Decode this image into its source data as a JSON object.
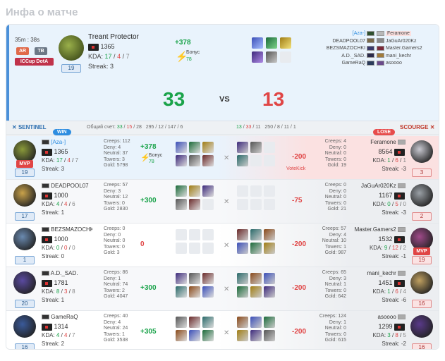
{
  "page_title": "Инфа о матче",
  "match": {
    "duration": "35m : 38s",
    "modes": [
      "AR",
      "TB"
    ],
    "league": "ICCup DotA",
    "hero_name": "Treant Protector",
    "rating": "1365",
    "kda_label": "KDA:",
    "kda": [
      "17",
      "4",
      "7"
    ],
    "streak": "Streak: 3",
    "level": "19",
    "points": "+378",
    "bonus_label": "Бонус",
    "bonus_value": "78",
    "score_left": "33",
    "vs": "VS",
    "score_right": "13",
    "roster_left": [
      "[Aza-]",
      "DEADPOOL07",
      "BEZSMAZOCHKI",
      "A.D._SAD.",
      "GameRaQ"
    ],
    "roster_right": [
      "Feramone",
      "JaGuAr020Kz",
      "Master.Gamers2",
      "mani_kechr",
      "asoooo"
    ]
  },
  "teams_bar": {
    "sentinel": "SENTINEL",
    "win": "WIN",
    "total_label": "Общий счет:",
    "left_stats": [
      "33",
      "15",
      "28"
    ],
    "left_extra": [
      "295",
      "12",
      "147",
      "6"
    ],
    "right_stats": [
      "13",
      "33",
      "11"
    ],
    "right_extra": [
      "250",
      "8",
      "11",
      "1"
    ],
    "lose": "LOSE",
    "scourge": "SCOURGE"
  },
  "rows": [
    {
      "left": {
        "name": "[Aza-]",
        "rating": "1365",
        "kda": [
          "17",
          "4",
          "7"
        ],
        "streak": "Streak: 3",
        "level": "19",
        "mvp": "MVP",
        "creeps": "Creeps: 112",
        "deny": "Deny: 4",
        "neutral": "Neutral: 37",
        "towers": "Towers: 3",
        "gold": "Gold: 5798",
        "points": "+378",
        "bonus": "Бонус",
        "bonus_value": "78"
      },
      "right": {
        "name": "Feramone",
        "rating": "8564",
        "kda": [
          "1",
          "6",
          "1"
        ],
        "streak": "Streak: -3",
        "level": "3",
        "creeps": "Creeps: 4",
        "deny": "Deny: 0",
        "neutral": "Neutral: 0",
        "towers": "Towers: 0",
        "gold": "Gold: 19",
        "points": "-200",
        "note": "VoteKick"
      }
    },
    {
      "left": {
        "name": "DEADPOOL07",
        "rating": "1000",
        "kda": [
          "4",
          "4",
          "6"
        ],
        "streak": "Streak: 1",
        "level": "17",
        "creeps": "Creeps: 57",
        "deny": "Deny: 3",
        "neutral": "Neutral: 12",
        "towers": "Towers: 0",
        "gold": "Gold: 2830",
        "points": "+300"
      },
      "right": {
        "name": "JaGuAr020Kz",
        "rating": "1167",
        "kda": [
          "0",
          "5",
          "0"
        ],
        "streak": "Streak: -3",
        "level": "2",
        "creeps": "Creeps: 0",
        "deny": "Deny: 0",
        "neutral": "Neutral: 0",
        "towers": "Towers: 0",
        "gold": "Gold: 21",
        "points": "-75"
      }
    },
    {
      "left": {
        "name": "BEZSMAZOCHKI",
        "rating": "1000",
        "kda": [
          "0",
          "0",
          "0"
        ],
        "streak": "Streak: 0",
        "level": "1",
        "creeps": "Creeps: 0",
        "deny": "Deny: 0",
        "neutral": "Neutral: 0",
        "towers": "Towers: 0",
        "gold": "Gold: 3",
        "points": "0"
      },
      "right": {
        "name": "Master.Gamers2",
        "rating": "1532",
        "kda": [
          "9",
          "12",
          "2"
        ],
        "streak": "Streak: -1",
        "level": "19",
        "mvp": "MVP",
        "creeps": "Creeps: 57",
        "deny": "Deny: 4",
        "neutral": "Neutral: 10",
        "towers": "Towers: 1",
        "gold": "Gold: 987",
        "points": "-200"
      }
    },
    {
      "left": {
        "name": "A.D._SAD.",
        "rating": "1781",
        "kda": [
          "8",
          "3",
          "8"
        ],
        "streak": "Streak: 1",
        "level": "20",
        "creeps": "Creeps: 86",
        "deny": "Deny: 1",
        "neutral": "Neutral: 74",
        "towers": "Towers: 2",
        "gold": "Gold: 4047",
        "points": "+300"
      },
      "right": {
        "name": "mani_kechr",
        "rating": "1451",
        "kda": [
          "1",
          "6",
          "4"
        ],
        "streak": "Streak: -6",
        "level": "16",
        "creeps": "Creeps: 65",
        "deny": "Deny: 3",
        "neutral": "Neutral: 1",
        "towers": "Towers: 0",
        "gold": "Gold: 642",
        "points": "-200"
      }
    },
    {
      "left": {
        "name": "GameRaQ",
        "rating": "1314",
        "kda": [
          "4",
          "4",
          "7"
        ],
        "streak": "Streak: 2",
        "level": "16",
        "creeps": "Creeps: 40",
        "deny": "Deny: 4",
        "neutral": "Neutral: 24",
        "towers": "Towers: 1",
        "gold": "Gold: 3538",
        "points": "+305"
      },
      "right": {
        "name": "asoooo",
        "rating": "1299",
        "kda": [
          "3",
          "8",
          "5"
        ],
        "streak": "Streak: -2",
        "level": "16",
        "creeps": "Creeps: 124",
        "deny": "Deny: 1",
        "neutral": "Neutral: 0",
        "towers": "Towers: 0",
        "gold": "Gold: 615",
        "points": "-200"
      }
    }
  ],
  "colors": {
    "accent": "#2e8de0",
    "win": "#1aa34a",
    "lose": "#e04545"
  }
}
